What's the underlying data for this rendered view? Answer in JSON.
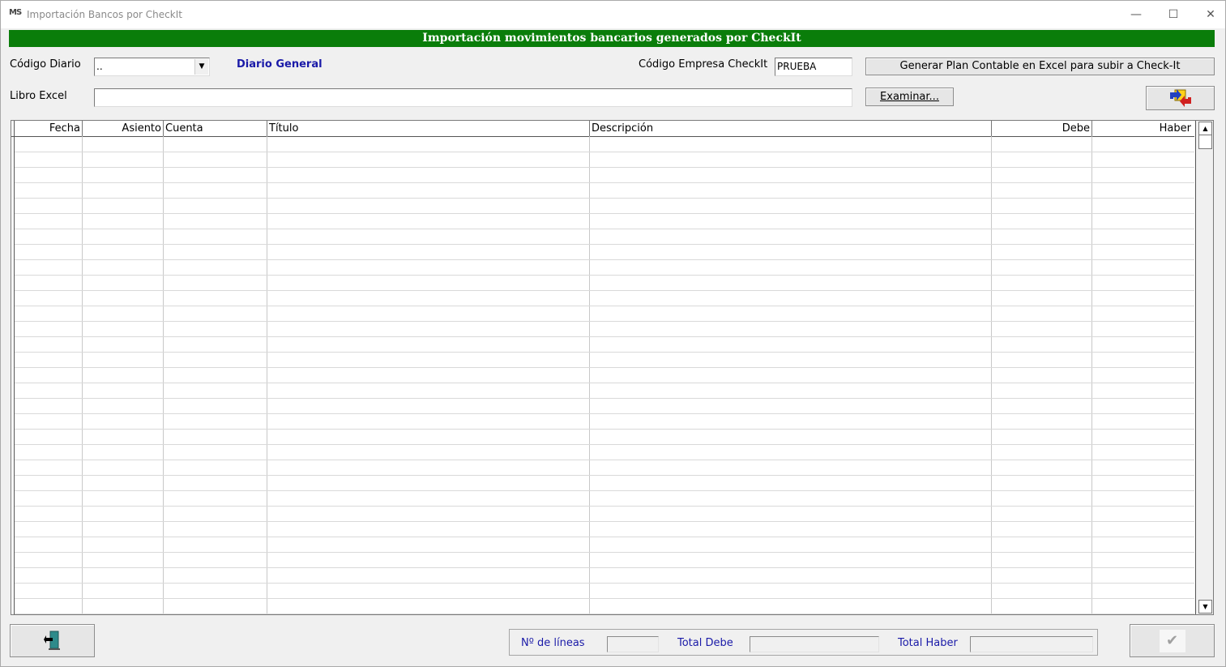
{
  "window": {
    "app_icon_text": "MS",
    "title": "Importación Bancos por CheckIt",
    "minimize_glyph": "—",
    "maximize_glyph": "☐",
    "close_glyph": "✕"
  },
  "banner": {
    "text": "Importación movimientos bancarios generados por CheckIt",
    "color": "#0a7d0a"
  },
  "form": {
    "codigo_diario_label": "Código Diario",
    "codigo_diario_value": "..",
    "diario_name": "Diario General",
    "codigo_empresa_label": "Código Empresa CheckIt",
    "codigo_empresa_value": "PRUEBA",
    "generar_button": "Generar Plan Contable en Excel para subir a Check-It",
    "libro_excel_label": "Libro Excel",
    "libro_excel_value": "",
    "examinar_button": "Examinar..."
  },
  "grid": {
    "columns": [
      "Fecha",
      "Asiento",
      "Cuenta",
      "Título",
      "Descripción",
      "Debe",
      "Haber"
    ],
    "rows": []
  },
  "footer": {
    "lineas_label": "Nº de líneas",
    "lineas_value": "",
    "total_debe_label": "Total Debe",
    "total_debe_value": "",
    "total_haber_label": "Total Haber",
    "total_haber_value": "",
    "accent_blue": "#1a1aa8"
  }
}
